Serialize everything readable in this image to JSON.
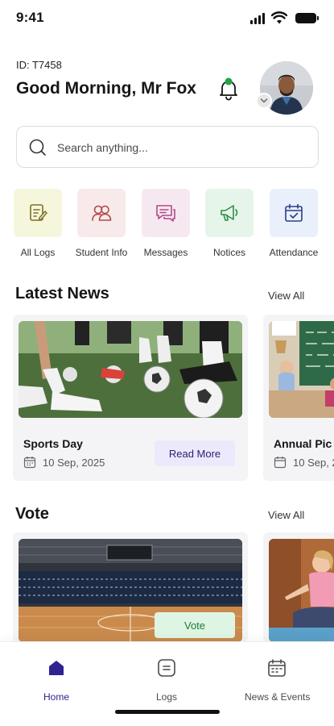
{
  "status_bar": {
    "time": "9:41"
  },
  "header": {
    "user_id": "ID: T7458",
    "greeting": "Good Morning, Mr Fox"
  },
  "search": {
    "placeholder": "Search anything..."
  },
  "quick_actions": [
    {
      "label": "All Logs",
      "icon": "edit-note-icon",
      "bg": "#f6f6dd",
      "color": "#7a7424"
    },
    {
      "label": "Student Info",
      "icon": "users-icon",
      "bg": "#f8eaea",
      "color": "#b14a4a"
    },
    {
      "label": "Messages",
      "icon": "chat-icon",
      "bg": "#f6e8f1",
      "color": "#b04a86"
    },
    {
      "label": "Notices",
      "icon": "megaphone-icon",
      "bg": "#e6f5e9",
      "color": "#2f8f45"
    },
    {
      "label": "Attendance",
      "icon": "calendar-check-icon",
      "bg": "#e9f0fb",
      "color": "#2c3f88"
    }
  ],
  "latest_news": {
    "title": "Latest News",
    "view_all": "View All",
    "cards": [
      {
        "title": "Sports Day",
        "date": "10 Sep, 2025",
        "button": "Read More"
      },
      {
        "title": "Annual Pic",
        "date": "10 Sep, 2"
      }
    ]
  },
  "vote": {
    "title": "Vote",
    "view_all": "View All",
    "cards": [
      {
        "button": "Vote"
      }
    ]
  },
  "bottom_nav": [
    {
      "label": "Home",
      "icon": "home-icon",
      "active": true
    },
    {
      "label": "Logs",
      "icon": "logs-icon",
      "active": false
    },
    {
      "label": "News & Events",
      "icon": "news-calendar-icon",
      "active": false
    }
  ],
  "colors": {
    "accent": "#2f2391",
    "read_more_bg": "#ebe9fb",
    "vote_bg": "#dff5e3",
    "bell_dot": "#22a447"
  }
}
